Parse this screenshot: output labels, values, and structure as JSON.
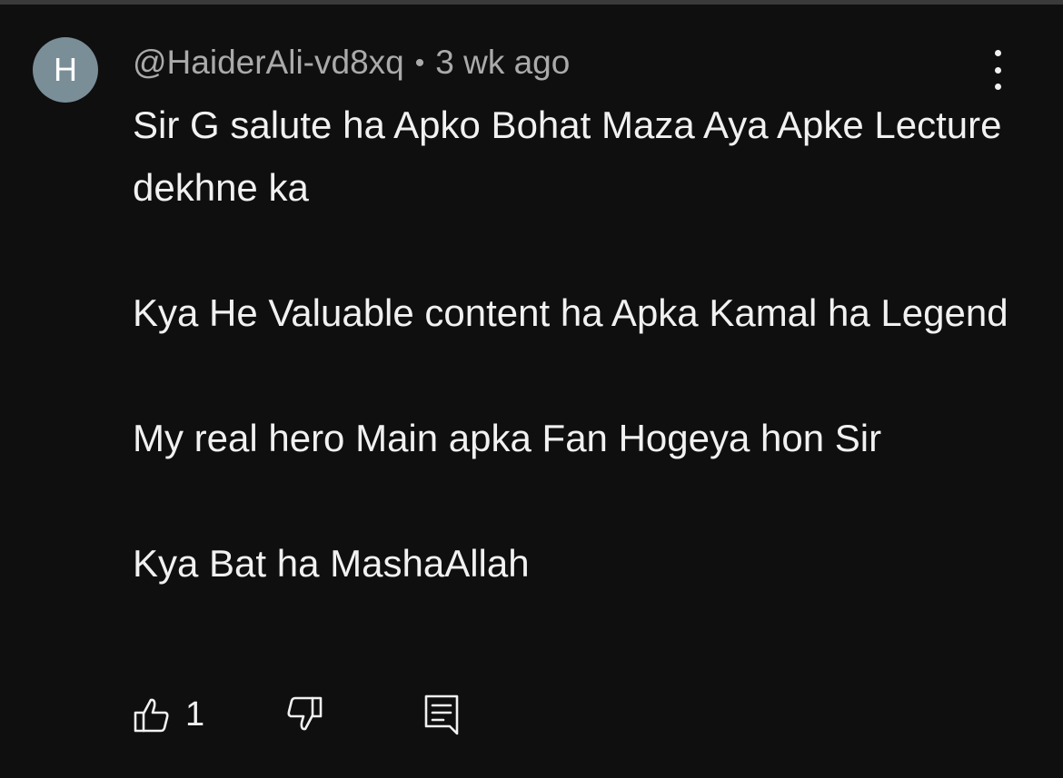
{
  "comment": {
    "avatar_letter": "H",
    "author": "@HaiderAli-vd8xq",
    "separator": "•",
    "time": "3 wk ago",
    "paragraphs": [
      "Sir G salute ha Apko Bohat Maza Aya Apke Lecture dekhne ka",
      "Kya He Valuable content ha Apka Kamal ha Legend",
      "My real hero Main apka Fan Hogeya hon Sir",
      "Kya Bat ha MashaAllah"
    ],
    "like_count": "1"
  },
  "icons": {
    "more": "vertical-dots-icon",
    "like": "thumbs-up-icon",
    "dislike": "thumbs-down-icon",
    "reply": "comment-reply-icon"
  },
  "colors": {
    "background": "#0f0f0f",
    "text": "#f1f1f1",
    "secondary_text": "#aaaaaa",
    "avatar": "#7a8e98"
  }
}
